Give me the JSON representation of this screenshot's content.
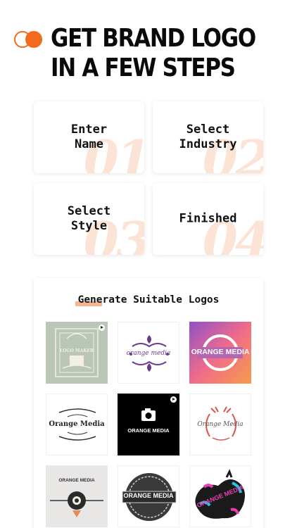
{
  "header": {
    "title_line1": "GET BRAND LOGO",
    "title_line2": "IN A FEW STEPS",
    "accent": "#f26a1b"
  },
  "steps": [
    {
      "label": "Enter\nName",
      "number": "01"
    },
    {
      "label": "Select\nIndustry",
      "number": "02"
    },
    {
      "label": "Select\nStyle",
      "number": "03"
    },
    {
      "label": "Finished",
      "number": "04"
    }
  ],
  "generate": {
    "title": "Generate Suitable Logos",
    "logos": [
      {
        "name": "logo-maker-vintage",
        "text": "LOGO MAKER"
      },
      {
        "name": "orange-media-ornament-purple",
        "text": "orange media"
      },
      {
        "name": "orange-media-gradient",
        "text": "ORANGE MEDIA"
      },
      {
        "name": "orange-media-blackletter",
        "text": "Orange Media"
      },
      {
        "name": "orange-media-camera-black",
        "text": "ORANGE MEDIA"
      },
      {
        "name": "orange-media-laurel",
        "text": "Orange Media"
      },
      {
        "name": "orange-media-lens",
        "text": "ORANGE MEDIA"
      },
      {
        "name": "orange-media-badge",
        "text": "ORANGE MEDIA"
      },
      {
        "name": "orange-media-grunge",
        "text": "ORANGE MEDIA"
      }
    ]
  }
}
